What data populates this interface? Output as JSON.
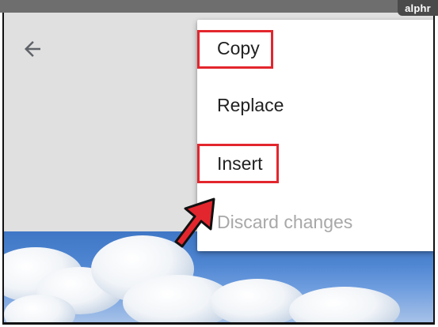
{
  "header": {
    "back_icon": "arrow-left-icon"
  },
  "menu": {
    "items": [
      {
        "label": "Copy",
        "enabled": true,
        "highlighted": true
      },
      {
        "label": "Replace",
        "enabled": true,
        "highlighted": false
      },
      {
        "label": "Insert",
        "enabled": true,
        "highlighted": true
      },
      {
        "label": "Discard changes",
        "enabled": false,
        "highlighted": false
      }
    ]
  },
  "annotation": {
    "highlight_color": "#e3262d",
    "pointer_icon": "red-arrow-icon"
  },
  "watermark": {
    "logo_text": "alphr"
  },
  "colors": {
    "appbar": "#e0e0e0",
    "menu_text": "#212121",
    "disabled_text": "#a8a8a8"
  }
}
